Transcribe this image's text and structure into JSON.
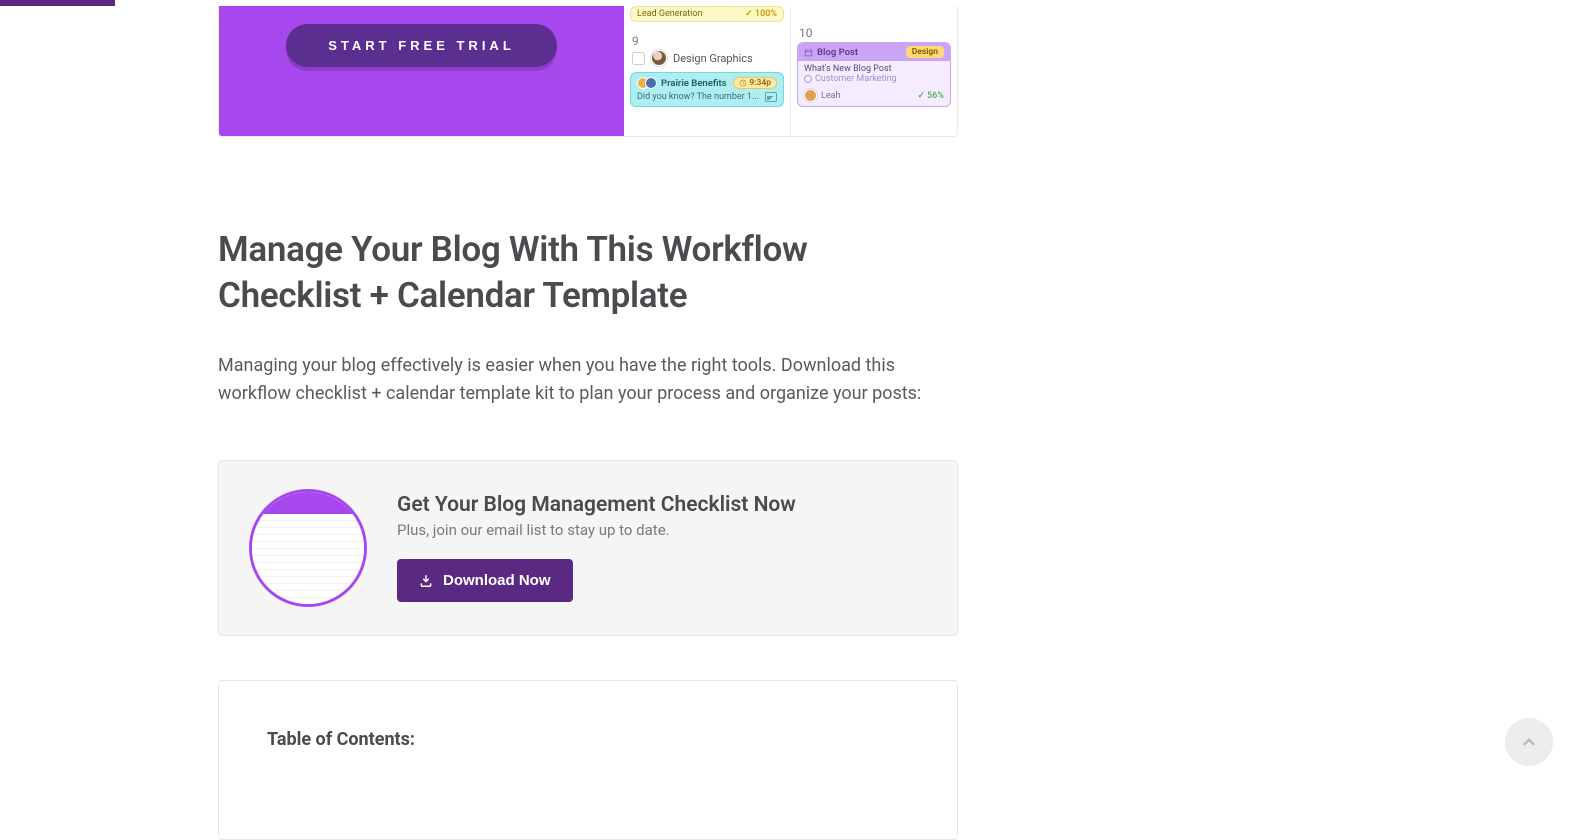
{
  "hero": {
    "cta_label": "START FREE TRIAL",
    "cell1_pill_text": "Lead Generation",
    "cell1_pill_stat": "✓ 100%",
    "cell1_daynum": "9",
    "cell1_task": "Design Graphics",
    "cell1_card_title": "Prairie Benefits",
    "cell1_card_badge": "9:34p",
    "cell1_card_line": "Did you know? The number 1...",
    "cell2_daynum": "10",
    "cell2_card_head_tag": "Blog Post",
    "cell2_card_head_label": "Design",
    "cell2_card_line1": "What's New Blog Post",
    "cell2_card_line2": "Customer Marketing",
    "cell2_card_owner": "Leah",
    "cell2_card_progress": "56%"
  },
  "article": {
    "heading": "Manage Your Blog With This Workflow Checklist + Calendar Template",
    "paragraph": "Managing your blog effectively is easier when you have the right tools. Download this workflow checklist + calendar template kit to plan your process and organize your posts:"
  },
  "cta": {
    "title": "Get Your Blog Management Checklist Now",
    "subtitle": "Plus, join our email list to stay up to date.",
    "button_label": "Download Now"
  },
  "toc": {
    "title": "Table of Contents:"
  }
}
